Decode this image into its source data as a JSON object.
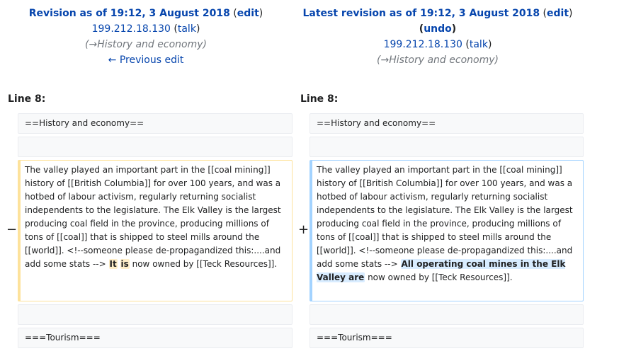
{
  "left_header": {
    "title": "Revision as of 19:12, 3 August 2018",
    "edit_label": "edit",
    "user": "199.212.18.130",
    "talk_label": "talk",
    "summary_arrow": "→",
    "summary": "History and economy",
    "prev_edit_label": "← Previous edit"
  },
  "right_header": {
    "title": "Latest revision as of 19:12, 3 August 2018",
    "edit_label": "edit",
    "undo_label": "undo",
    "user": "199.212.18.130",
    "talk_label": "talk",
    "summary_arrow": "→",
    "summary": "History and economy"
  },
  "left_line": "Line 8:",
  "right_line": "Line 8:",
  "context_line_1": "==History and economy==",
  "context_line_2": "",
  "context_line_3": "",
  "context_line_4": "===Tourism===",
  "removed_marker": "−",
  "added_marker": "+",
  "removed": {
    "text_before": "The valley played an important part in the [[coal mining]] history of [[British Columbia]] for over 100 years, and was a hotbed of labour activism, regularly returning socialist independents to the legislature. The Elk Valley is the largest producing coal field in the province, producing millions of tons of [[coal]] that is shipped to steel mills around the [[world]]. <!--someone please de-propagandized this:....and add some stats --> ",
    "highlight_1": "It",
    "text_gap": " ",
    "highlight_2": "is",
    "text_after": " now owned by [[Teck Resources]]."
  },
  "added": {
    "text_before": "The valley played an important part in the [[coal mining]] history of [[British Columbia]] for over 100 years, and was a hotbed of labour activism, regularly returning socialist independents to the legislature. The Elk Valley is the largest producing coal field in the province, producing millions of tons of [[coal]] that is shipped to steel mills around the [[world]]. <!--someone please de-propagandized this:....and add some stats --> ",
    "highlight": "All operating coal mines in the Elk Valley are",
    "text_after": " now owned by [[Teck Resources]]."
  }
}
